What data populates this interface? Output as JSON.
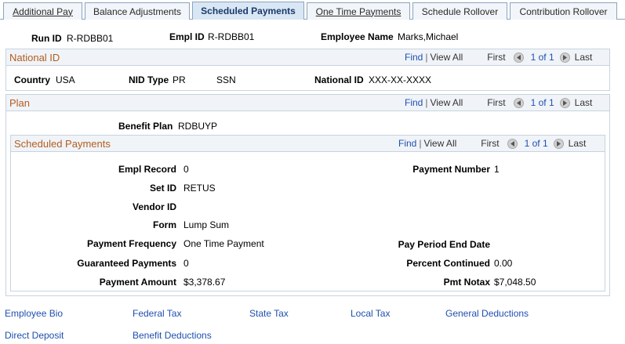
{
  "tabs": [
    {
      "label": "Additional Pay"
    },
    {
      "label": "Balance Adjustments"
    },
    {
      "label": "Scheduled Payments"
    },
    {
      "label": "One Time Payments"
    },
    {
      "label": "Schedule Rollover"
    },
    {
      "label": "Contribution Rollover"
    }
  ],
  "header": {
    "run_id_label": "Run ID",
    "run_id": "R-RDBB01",
    "empl_id_label": "Empl ID",
    "empl_id": "R-RDBB01",
    "employee_name_label": "Employee Name",
    "employee_name": "Marks,Michael"
  },
  "nav": {
    "find": "Find",
    "sep": "|",
    "view_all": "View All",
    "first": "First",
    "range": "1 of 1",
    "last": "Last"
  },
  "national_id": {
    "title": "National ID",
    "country_label": "Country",
    "country": "USA",
    "nid_type_label": "NID Type",
    "nid_type": "PR",
    "nid_type2": "SSN",
    "national_id_label": "National ID",
    "national_id": "XXX-XX-XXXX"
  },
  "plan": {
    "title": "Plan",
    "benefit_plan_label": "Benefit Plan",
    "benefit_plan": "RDBUYP"
  },
  "scheduled": {
    "title": "Scheduled Payments",
    "empl_record_label": "Empl Record",
    "empl_record": "0",
    "payment_number_label": "Payment Number",
    "payment_number": "1",
    "set_id_label": "Set ID",
    "set_id": "RETUS",
    "vendor_id_label": "Vendor ID",
    "form_label": "Form",
    "form": "Lump Sum",
    "payment_frequency_label": "Payment Frequency",
    "payment_frequency": "One Time Payment",
    "pay_period_end_label": "Pay Period End Date",
    "guaranteed_label": "Guaranteed Payments",
    "guaranteed": "0",
    "percent_label": "Percent Continued",
    "percent": "0.00",
    "amount_label": "Payment Amount",
    "amount": "$3,378.67",
    "notax_label": "Pmt Notax",
    "notax": "$7,048.50"
  },
  "footer": {
    "links": [
      "Employee Bio",
      "Federal Tax",
      "State Tax",
      "Local Tax",
      "General Deductions",
      "Direct Deposit",
      "Benefit Deductions"
    ]
  }
}
